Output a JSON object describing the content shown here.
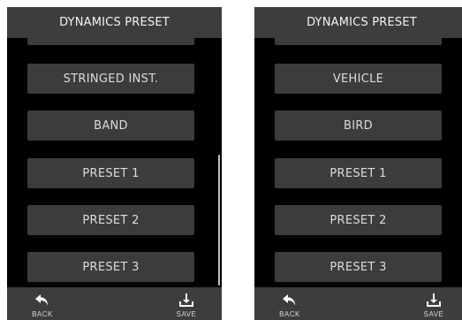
{
  "left_screen": {
    "title": "DYNAMICS PRESET",
    "partial_item": "",
    "items": [
      "STRINGED INST.",
      "BAND",
      "PRESET 1",
      "PRESET 2",
      "PRESET 3"
    ],
    "footer": {
      "back_label": "BACK",
      "save_label": "SAVE"
    },
    "back_icon": "back-arrow-icon",
    "save_icon": "download-tray-icon"
  },
  "right_screen": {
    "title": "DYNAMICS PRESET",
    "partial_item": "",
    "items": [
      "VEHICLE",
      "BIRD",
      "PRESET 1",
      "PRESET 2",
      "PRESET 3"
    ],
    "footer": {
      "back_label": "BACK",
      "save_label": "SAVE"
    },
    "back_icon": "back-arrow-icon",
    "save_icon": "download-tray-icon"
  },
  "colors": {
    "background": "#000000",
    "bar": "#3d3d3d",
    "button": "#3c3c3c",
    "text": "#dcdcdc"
  }
}
